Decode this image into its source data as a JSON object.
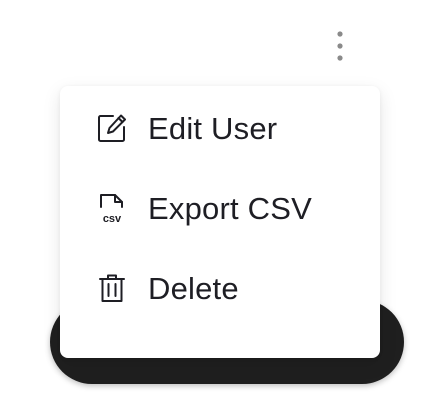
{
  "header": {
    "more_icon": "kebab-vertical-icon"
  },
  "menu": {
    "items": [
      {
        "label": "Edit User",
        "icon": "edit-icon"
      },
      {
        "label": "Export CSV",
        "icon": "csv-file-icon",
        "icon_text": "csv"
      },
      {
        "label": "Delete",
        "icon": "trash-icon"
      }
    ]
  },
  "colors": {
    "text": "#1e1e24",
    "kebab": "#8a8a8a",
    "backdrop": "#1f1f1f",
    "menu_bg": "#ffffff"
  }
}
